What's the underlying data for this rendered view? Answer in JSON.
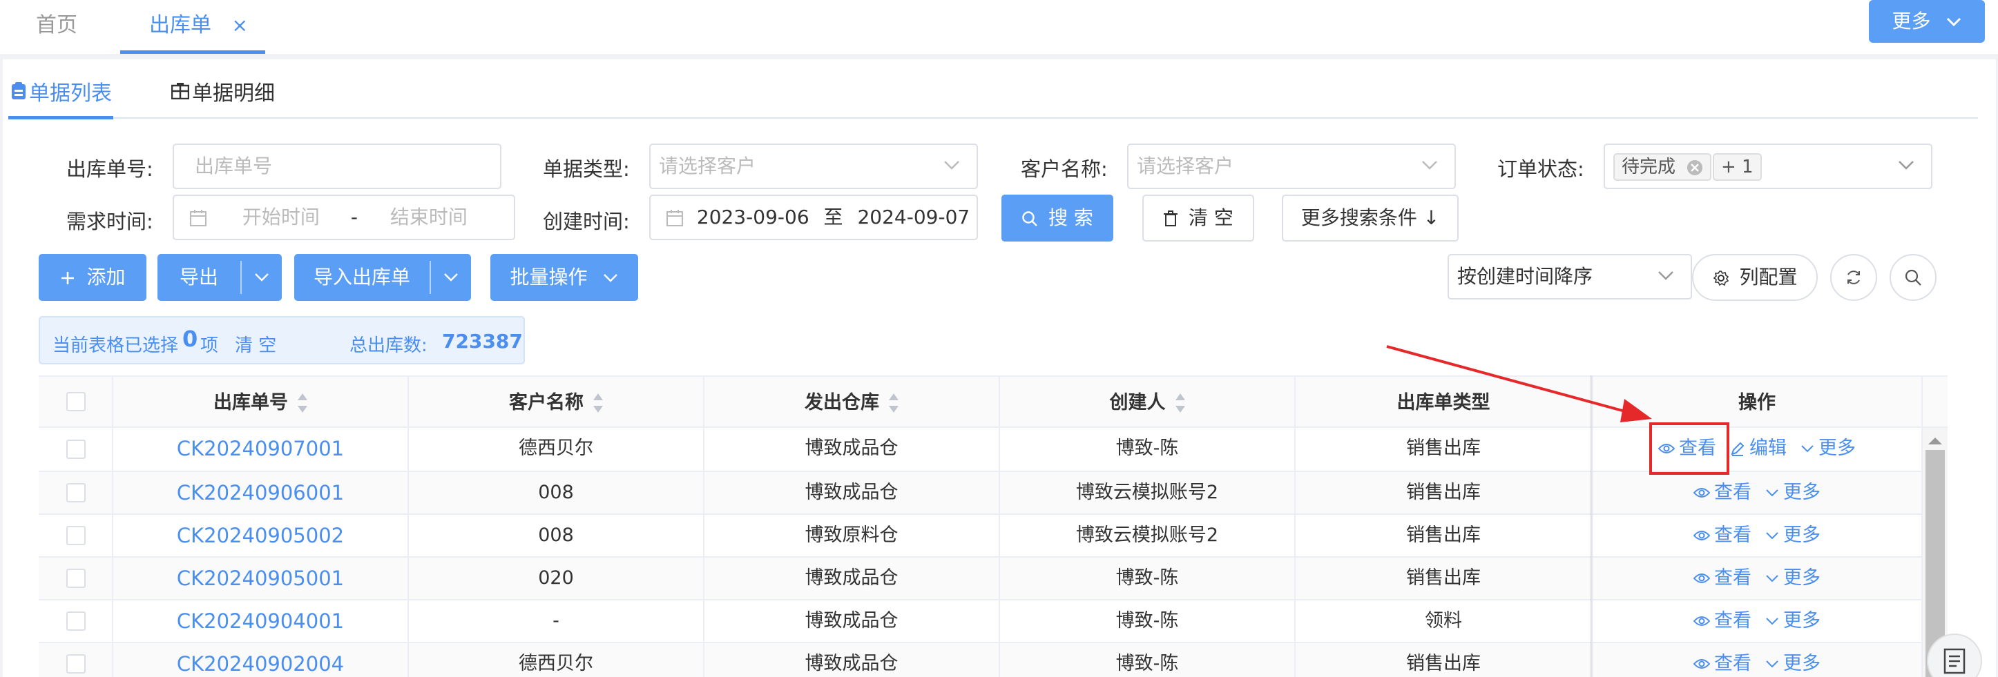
{
  "top_tabs": [
    {
      "label": "首页"
    },
    {
      "label": "出库单",
      "close": "×"
    }
  ],
  "top_more": "更多",
  "sub_tabs": [
    {
      "label": "单据列表"
    },
    {
      "label": "单据明细"
    }
  ],
  "filters": {
    "out_no_label": "出库单号:",
    "out_no_placeholder": "出库单号",
    "doc_type_label": "单据类型:",
    "doc_type_placeholder": "请选择客户",
    "customer_label": "客户名称:",
    "customer_placeholder": "请选择客户",
    "status_label": "订单状态:",
    "status_tag": "待完成",
    "status_more": "+ 1",
    "demand_label": "需求时间:",
    "demand_start": "开始时间",
    "demand_sep": "-",
    "demand_end": "结束时间",
    "created_label": "创建时间:",
    "created_start": "2023-09-06",
    "created_sep": "至",
    "created_end": "2024-09-07",
    "search_btn": "搜 索",
    "clear_btn": "清 空",
    "more_cond_btn": "更多搜索条件 ↓"
  },
  "toolbar": {
    "add": "添加",
    "export": "导出",
    "import": "导入出库单",
    "batch": "批量操作",
    "sort_select": "按创建时间降序",
    "col_config": "列配置"
  },
  "summary": {
    "selected_prefix": "当前表格已选择",
    "selected_count": "0",
    "selected_suffix": "项",
    "clear": "清 空",
    "total_label": "总出库数:",
    "total_value": "723387"
  },
  "table": {
    "headers": [
      "出库单号",
      "客户名称",
      "发出仓库",
      "创建人",
      "出库单类型",
      "操作"
    ],
    "rows": [
      {
        "no": "CK20240907001",
        "customer": "德西贝尔",
        "warehouse": "博致成品仓",
        "creator": "博致-陈",
        "type": "销售出库",
        "edit": true
      },
      {
        "no": "CK20240906001",
        "customer": "008",
        "warehouse": "博致成品仓",
        "creator": "博致云模拟账号2",
        "type": "销售出库",
        "edit": false
      },
      {
        "no": "CK20240905002",
        "customer": "008",
        "warehouse": "博致原料仓",
        "creator": "博致云模拟账号2",
        "type": "销售出库",
        "edit": false
      },
      {
        "no": "CK20240905001",
        "customer": "020",
        "warehouse": "博致成品仓",
        "creator": "博致-陈",
        "type": "销售出库",
        "edit": false
      },
      {
        "no": "CK20240904001",
        "customer": "-",
        "warehouse": "博致成品仓",
        "creator": "博致-陈",
        "type": "领料",
        "edit": false
      },
      {
        "no": "CK20240902004",
        "customer": "德西贝尔",
        "warehouse": "博致成品仓",
        "creator": "博致-陈",
        "type": "销售出库",
        "edit": false
      }
    ],
    "op_view": "查看",
    "op_edit": "编辑",
    "op_more": "更多"
  },
  "colors": {
    "primary": "#5b9ef5",
    "link": "#4a8ff0",
    "annotation": "#e5292b"
  },
  "icons": [
    "close-icon",
    "clipboard-icon",
    "table-icon",
    "chevron-down-icon",
    "calendar-icon",
    "search-icon",
    "trash-icon",
    "plus-icon",
    "gear-icon",
    "refresh-icon",
    "eye-icon",
    "pencil-icon",
    "document-icon"
  ]
}
